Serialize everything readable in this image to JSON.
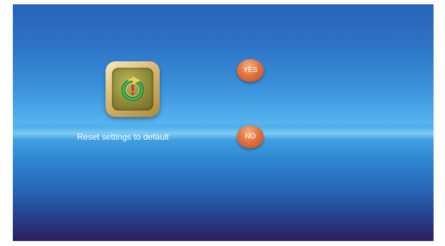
{
  "dialog": {
    "icon": "reset-settings-icon",
    "label": "Reset settings to default",
    "yes_label": "YES",
    "no_label": "NO"
  },
  "colors": {
    "background_top": "#2a64b8",
    "background_mid": "#55b4ee",
    "background_bottom": "#2a1f5e",
    "button": "#e2733e",
    "icon_frame": "#d8b66c",
    "icon_inner": "#8d8a36"
  }
}
